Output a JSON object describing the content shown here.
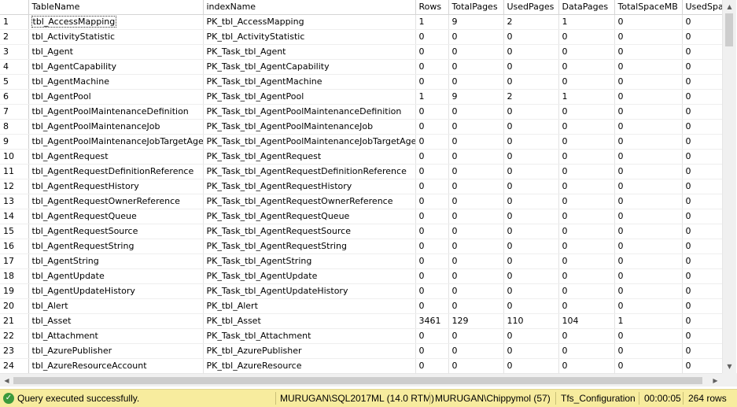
{
  "grid": {
    "columns": [
      "TableName",
      "indexName",
      "Rows",
      "TotalPages",
      "UsedPages",
      "DataPages",
      "TotalSpaceMB",
      "UsedSpac"
    ],
    "rows": [
      [
        "1",
        "tbl_AccessMapping",
        "PK_tbl_AccessMapping",
        "1",
        "9",
        "2",
        "1",
        "0",
        "0"
      ],
      [
        "2",
        "tbl_ActivityStatistic",
        "PK_tbl_ActivityStatistic",
        "0",
        "0",
        "0",
        "0",
        "0",
        "0"
      ],
      [
        "3",
        "tbl_Agent",
        "PK_Task_tbl_Agent",
        "0",
        "0",
        "0",
        "0",
        "0",
        "0"
      ],
      [
        "4",
        "tbl_AgentCapability",
        "PK_Task_tbl_AgentCapability",
        "0",
        "0",
        "0",
        "0",
        "0",
        "0"
      ],
      [
        "5",
        "tbl_AgentMachine",
        "PK_Task_tbl_AgentMachine",
        "0",
        "0",
        "0",
        "0",
        "0",
        "0"
      ],
      [
        "6",
        "tbl_AgentPool",
        "PK_Task_tbl_AgentPool",
        "1",
        "9",
        "2",
        "1",
        "0",
        "0"
      ],
      [
        "7",
        "tbl_AgentPoolMaintenanceDefinition",
        "PK_Task_tbl_AgentPoolMaintenanceDefinition",
        "0",
        "0",
        "0",
        "0",
        "0",
        "0"
      ],
      [
        "8",
        "tbl_AgentPoolMaintenanceJob",
        "PK_Task_tbl_AgentPoolMaintenanceJob",
        "0",
        "0",
        "0",
        "0",
        "0",
        "0"
      ],
      [
        "9",
        "tbl_AgentPoolMaintenanceJobTargetAgent",
        "PK_Task_tbl_AgentPoolMaintenanceJobTargetAgent",
        "0",
        "0",
        "0",
        "0",
        "0",
        "0"
      ],
      [
        "10",
        "tbl_AgentRequest",
        "PK_Task_tbl_AgentRequest",
        "0",
        "0",
        "0",
        "0",
        "0",
        "0"
      ],
      [
        "11",
        "tbl_AgentRequestDefinitionReference",
        "PK_Task_tbl_AgentRequestDefinitionReference",
        "0",
        "0",
        "0",
        "0",
        "0",
        "0"
      ],
      [
        "12",
        "tbl_AgentRequestHistory",
        "PK_Task_tbl_AgentRequestHistory",
        "0",
        "0",
        "0",
        "0",
        "0",
        "0"
      ],
      [
        "13",
        "tbl_AgentRequestOwnerReference",
        "PK_Task_tbl_AgentRequestOwnerReference",
        "0",
        "0",
        "0",
        "0",
        "0",
        "0"
      ],
      [
        "14",
        "tbl_AgentRequestQueue",
        "PK_Task_tbl_AgentRequestQueue",
        "0",
        "0",
        "0",
        "0",
        "0",
        "0"
      ],
      [
        "15",
        "tbl_AgentRequestSource",
        "PK_Task_tbl_AgentRequestSource",
        "0",
        "0",
        "0",
        "0",
        "0",
        "0"
      ],
      [
        "16",
        "tbl_AgentRequestString",
        "PK_Task_tbl_AgentRequestString",
        "0",
        "0",
        "0",
        "0",
        "0",
        "0"
      ],
      [
        "17",
        "tbl_AgentString",
        "PK_Task_tbl_AgentString",
        "0",
        "0",
        "0",
        "0",
        "0",
        "0"
      ],
      [
        "18",
        "tbl_AgentUpdate",
        "PK_Task_tbl_AgentUpdate",
        "0",
        "0",
        "0",
        "0",
        "0",
        "0"
      ],
      [
        "19",
        "tbl_AgentUpdateHistory",
        "PK_Task_tbl_AgentUpdateHistory",
        "0",
        "0",
        "0",
        "0",
        "0",
        "0"
      ],
      [
        "20",
        "tbl_Alert",
        "PK_tbl_Alert",
        "0",
        "0",
        "0",
        "0",
        "0",
        "0"
      ],
      [
        "21",
        "tbl_Asset",
        "PK_tbl_Asset",
        "3461",
        "129",
        "110",
        "104",
        "1",
        "0"
      ],
      [
        "22",
        "tbl_Attachment",
        "PK_Task_tbl_Attachment",
        "0",
        "0",
        "0",
        "0",
        "0",
        "0"
      ],
      [
        "23",
        "tbl_AzurePublisher",
        "PK_tbl_AzurePublisher",
        "0",
        "0",
        "0",
        "0",
        "0",
        "0"
      ],
      [
        "24",
        "tbl_AzureResourceAccount",
        "PK_tbl_AzureResource",
        "0",
        "0",
        "0",
        "0",
        "0",
        "0"
      ]
    ]
  },
  "status": {
    "message": "Query executed successfully.",
    "server": "MURUGAN\\SQL2017ML (14.0 RTM)",
    "user": "MURUGAN\\Chippymol (57)",
    "database": "Tfs_Configuration",
    "elapsed": "00:00:05",
    "row_count": "264 rows",
    "status_icon": "check-circle-icon",
    "bar_color": "#f7ec9e"
  },
  "icons": {
    "scroll_up": "▲",
    "scroll_down": "▼",
    "scroll_left": "◀",
    "scroll_right": "▶",
    "check": "✓"
  }
}
